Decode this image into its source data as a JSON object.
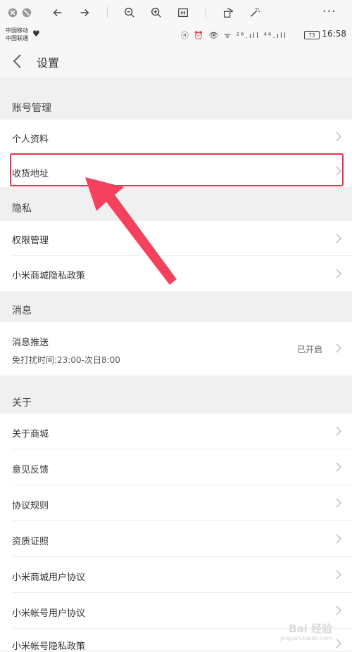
{
  "status": {
    "carrier1": "中国移动",
    "carrier2": "中国联通",
    "signal_info": "ⓝ ⏰ 👁 ᯤ ²⁶.ıll ⁴⁶.ıll",
    "battery": "73",
    "time": "16:58"
  },
  "nav": {
    "title": "设置"
  },
  "sections": {
    "account": "账号管理",
    "privacy": "隐私",
    "message": "消息",
    "about": "关于"
  },
  "items": {
    "profile": "个人资料",
    "address": "收货地址",
    "permission": "权限管理",
    "privacy_policy": "小米商城隐私政策",
    "push": "消息推送",
    "push_value": "已开启",
    "push_sub": "免打扰时间:23:00-次日8:00",
    "about_mall": "关于商城",
    "feedback": "意见反馈",
    "rules": "协议规则",
    "qualification": "资质证照",
    "mall_user_agreement": "小米商城用户协议",
    "account_user_agreement": "小米帐号用户协议",
    "account_privacy": "小米帐号隐私政策"
  },
  "watermark": {
    "main": "Bai 经验",
    "sub": "jingyan.baidu.com"
  },
  "colors": {
    "highlight": "#f0304e",
    "arrow": "#f4425e"
  }
}
